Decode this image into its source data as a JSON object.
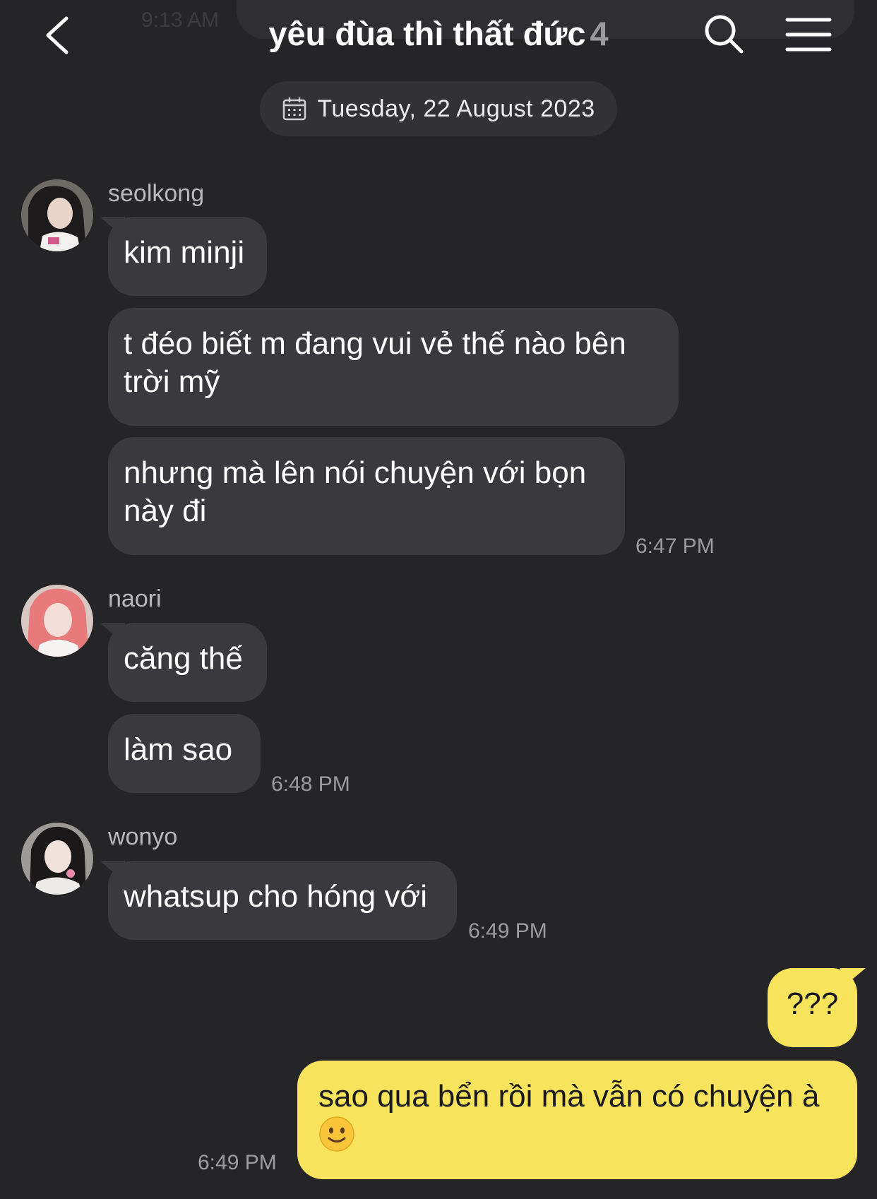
{
  "header": {
    "ghost_time": "9:13 AM",
    "title": "yêu đùa thì thất đức",
    "member_count": "4"
  },
  "date_divider": "Tuesday, 22 August 2023",
  "messages": {
    "group1": {
      "sender": "seolkong",
      "m1": "kim minji",
      "m2": "t đéo biết m đang vui vẻ thế nào bên trời mỹ",
      "m3": "nhưng mà lên nói chuyện với bọn này đi",
      "time": "6:47 PM"
    },
    "group2": {
      "sender": "naori",
      "m1": "căng thế",
      "m2": "làm sao",
      "time": "6:48 PM"
    },
    "group3": {
      "sender": "wonyo",
      "m1": "whatsup cho hóng với",
      "time": "6:49 PM"
    },
    "mine": {
      "m1": "???",
      "m2": "sao qua bển rồi mà vẫn có chuyện à",
      "emoji": "slightly-smiling-face",
      "time": "6:49 PM"
    }
  },
  "colors": {
    "background": "#252528",
    "incoming_bubble": "#3a3a3e",
    "outgoing_bubble": "#f8e45c"
  }
}
